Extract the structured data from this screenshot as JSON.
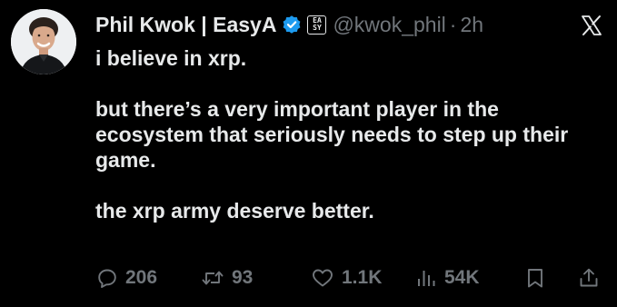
{
  "author": {
    "display_name": "Phil Kwok | EasyA",
    "handle": "@kwok_phil",
    "separator": "·",
    "time": "2h",
    "badge_line1": "EA",
    "badge_line2": "SY"
  },
  "tweet": {
    "lines": [
      "i believe in xrp.",
      "but there’s a very important player in the ecosystem that seriously needs to step up their game.",
      "the xrp army deserve better."
    ]
  },
  "actions": {
    "replies": "206",
    "reposts": "93",
    "likes": "1.1K",
    "views": "54K"
  },
  "icons": {
    "verified": "verified-badge-icon",
    "platform": "x-logo-icon",
    "reply": "reply-icon",
    "repost": "repost-icon",
    "like": "heart-icon",
    "views": "views-icon",
    "bookmark": "bookmark-icon",
    "share": "share-icon"
  },
  "colors": {
    "background": "#000000",
    "text": "#e7e9ea",
    "muted": "#71767b",
    "verified_blue": "#1d9bf0"
  }
}
